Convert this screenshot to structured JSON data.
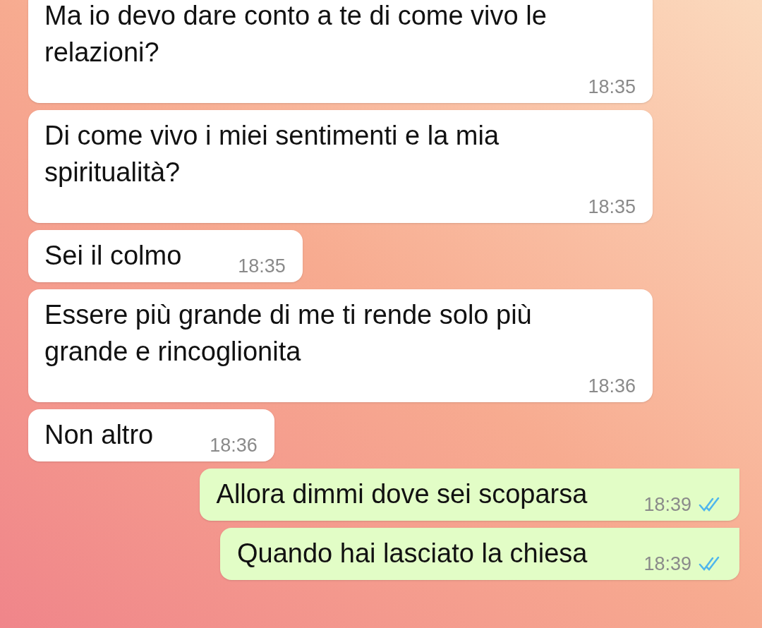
{
  "messages": [
    {
      "kind": "incoming",
      "text": "Ma io devo dare conto a te di come vivo le relazioni?",
      "time": "18:35"
    },
    {
      "kind": "incoming",
      "text": "Di come vivo i miei sentimenti e la mia spiritualità?",
      "time": "18:35"
    },
    {
      "kind": "incoming",
      "text": "Sei il colmo",
      "time": "18:35"
    },
    {
      "kind": "incoming",
      "text": "Essere più grande di me ti rende solo più grande e rincoglionita",
      "time": "18:36"
    },
    {
      "kind": "incoming",
      "text": "Non altro",
      "time": "18:36"
    },
    {
      "kind": "outgoing",
      "text": "Allora dimmi dove sei scoparsa",
      "time": "18:39",
      "read": true
    },
    {
      "kind": "outgoing",
      "text": "Quando hai lasciato la chiesa",
      "time": "18:39",
      "read": true
    }
  ]
}
